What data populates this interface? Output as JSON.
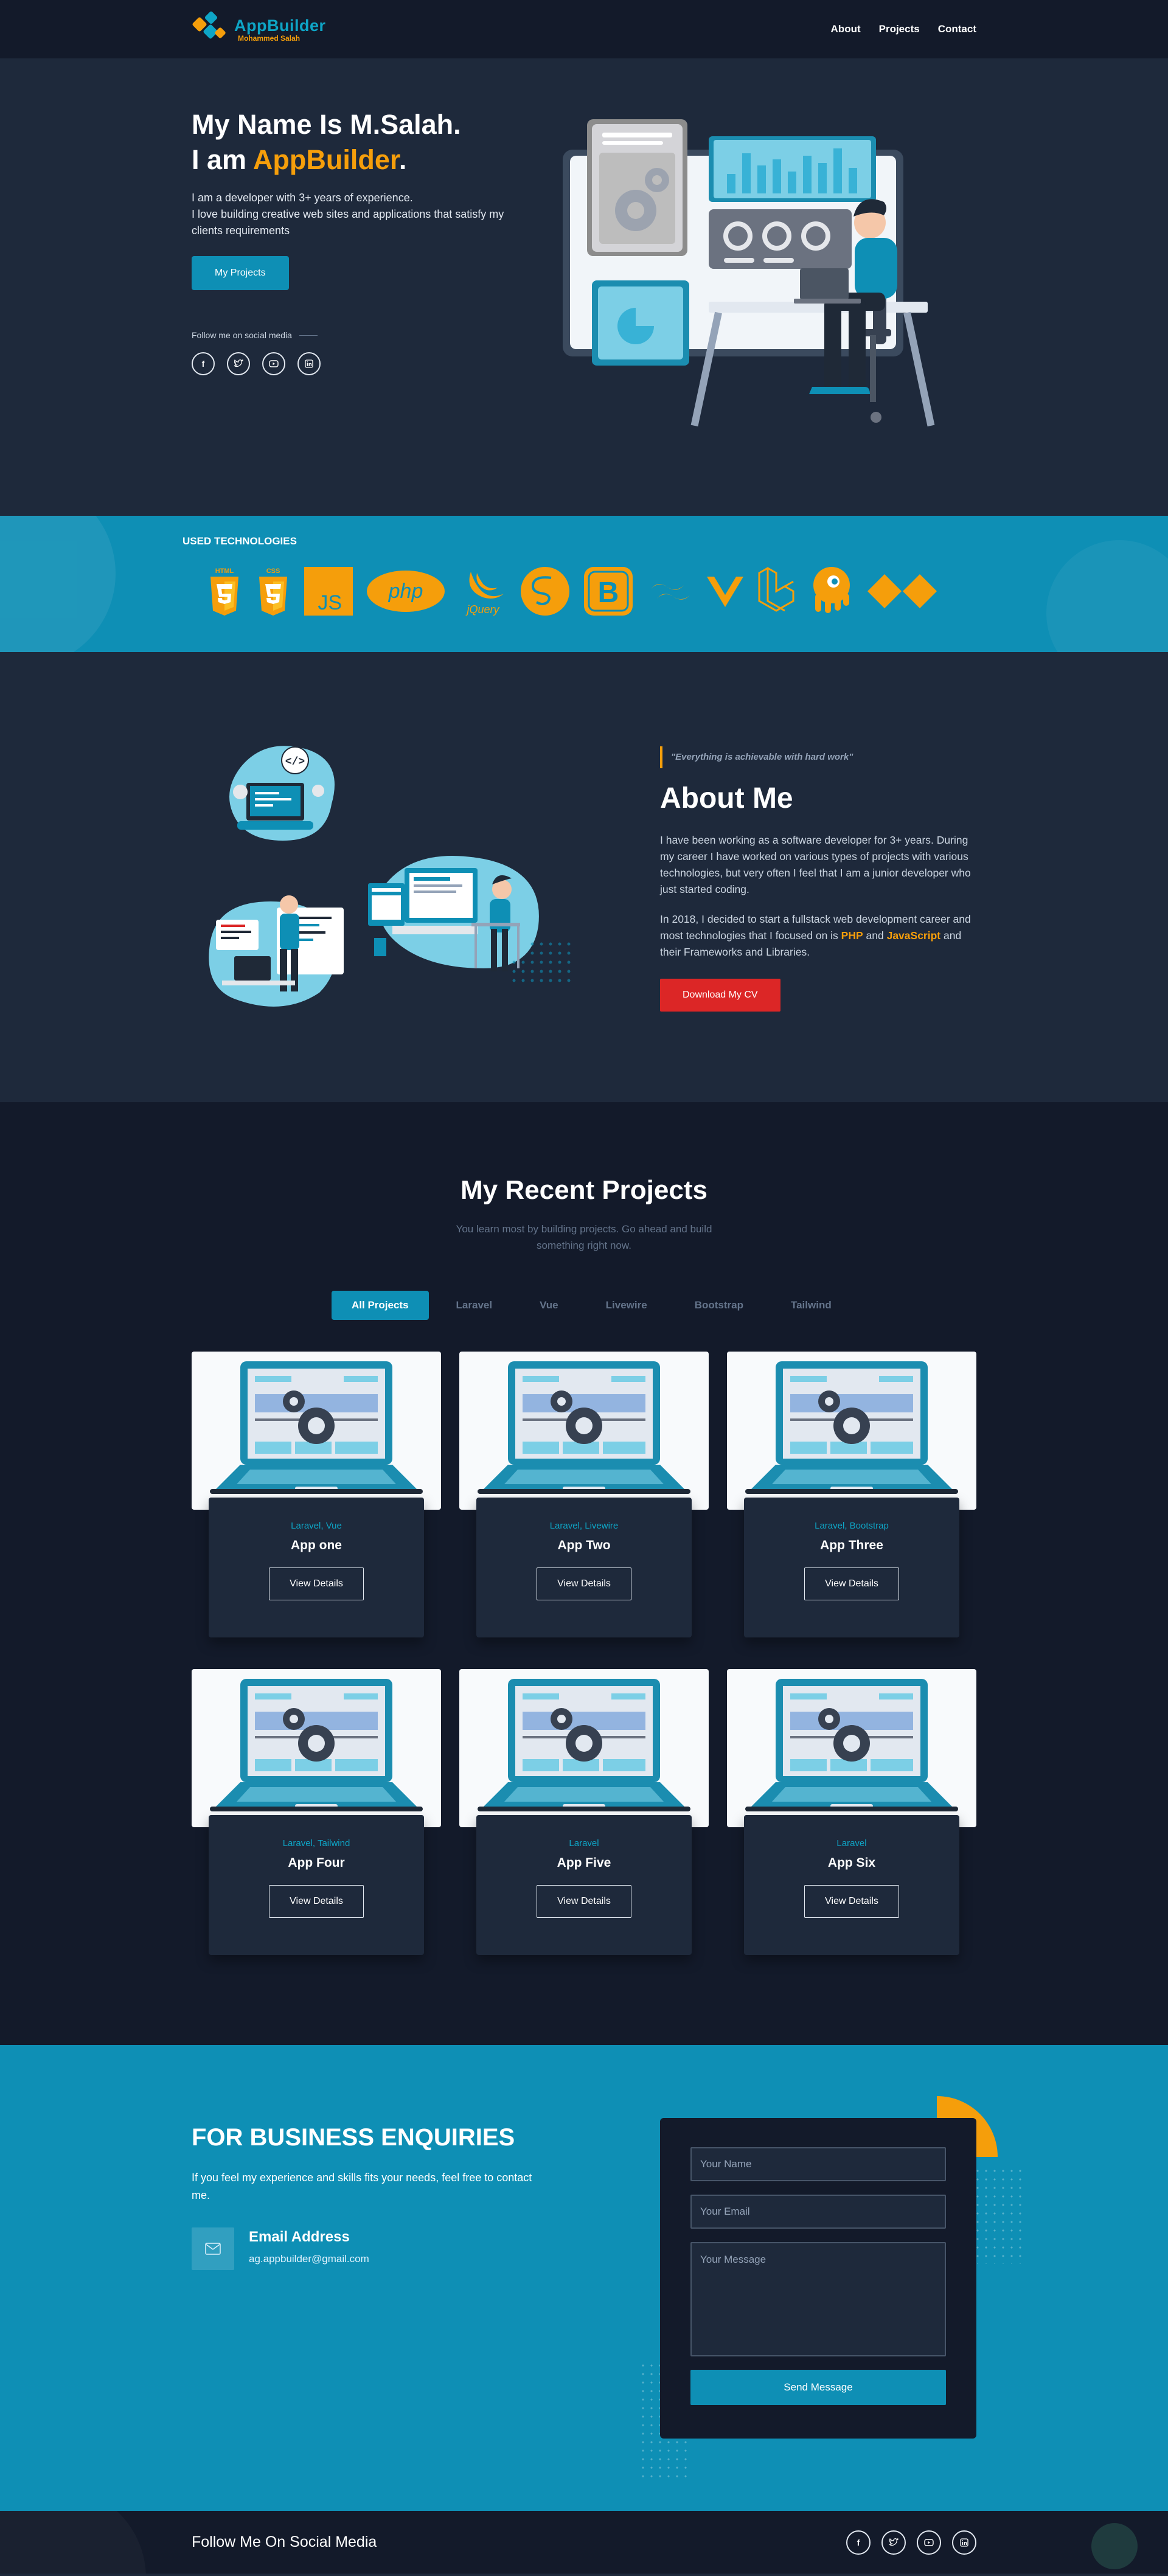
{
  "header": {
    "logo_name": "AppBuilder",
    "logo_sub": "Mohammed Salah",
    "nav": [
      "About",
      "Projects",
      "Contact"
    ]
  },
  "hero": {
    "name_line": "My Name Is M.Salah.",
    "role_prefix": "I am ",
    "role_accent": "AppBuilder",
    "role_suffix": ".",
    "description": "I am a developer with 3+ years of experience.\nI love building creative web sites and applications that satisfy my clients requirements",
    "button": "My Projects",
    "follow_text": "Follow me on social media",
    "social_icons": [
      "facebook-icon",
      "twitter-icon",
      "youtube-icon",
      "linkedin-icon"
    ]
  },
  "tech": {
    "title": "USED TECHNOLOGIES",
    "items": [
      "html5-icon",
      "css3-icon",
      "javascript-icon",
      "php-icon",
      "jquery-icon",
      "sass-icon",
      "bootstrap-icon",
      "tailwind-icon",
      "vue-icon",
      "laravel-icon",
      "livewire-icon",
      "alpine-icon"
    ]
  },
  "about": {
    "quote": "\"Everything is achievable with hard work\"",
    "title": "About Me",
    "p1": "I have been working as a software developer for 3+ years. During my career I have worked on various types of projects with various technologies, but very often I feel that I am a junior developer who just started coding.",
    "p2_start": "In 2018, I decided to start a fullstack web development career and most technologies that I focused on is ",
    "p2_php": "PHP",
    "p2_and": " and ",
    "p2_js": "JavaScript",
    "p2_end": " and their Frameworks and Libraries.",
    "button": "Download My CV"
  },
  "projects": {
    "title": "My Recent Projects",
    "subtitle": "You learn most by building projects. Go ahead and build something right now.",
    "filters": [
      "All Projects",
      "Laravel",
      "Vue",
      "Livewire",
      "Bootstrap",
      "Tailwind"
    ],
    "active_filter": "All Projects",
    "cards": [
      {
        "tags": "Laravel, Vue",
        "name": "App one",
        "button": "View Details"
      },
      {
        "tags": "Laravel, Livewire",
        "name": "App Two",
        "button": "View Details"
      },
      {
        "tags": "Laravel, Bootstrap",
        "name": "App Three",
        "button": "View Details"
      },
      {
        "tags": "Laravel, Tailwind",
        "name": "App Four",
        "button": "View Details"
      },
      {
        "tags": "Laravel",
        "name": "App Five",
        "button": "View Details"
      },
      {
        "tags": "Laravel",
        "name": "App Six",
        "button": "View Details"
      }
    ]
  },
  "contact": {
    "title": "FOR BUSINESS ENQUIRIES",
    "description": "If you feel my experience and skills fits your needs, feel free to contact me.",
    "email_label": "Email Address",
    "email_value": "ag.appbuilder@gmail.com",
    "name_placeholder": "Your Name",
    "email_placeholder": "Your Email",
    "message_placeholder": "Your Message",
    "send_button": "Send Message"
  },
  "footer": {
    "title": "Follow Me On Social Media",
    "social_icons": [
      "facebook-icon",
      "twitter-icon",
      "youtube-icon",
      "linkedin-icon"
    ]
  },
  "colors": {
    "accent": "#f59e0b",
    "primary": "#0e8fb5",
    "dark": "#131a2a",
    "panel": "#1e293b",
    "cv_button": "#dc2626"
  }
}
